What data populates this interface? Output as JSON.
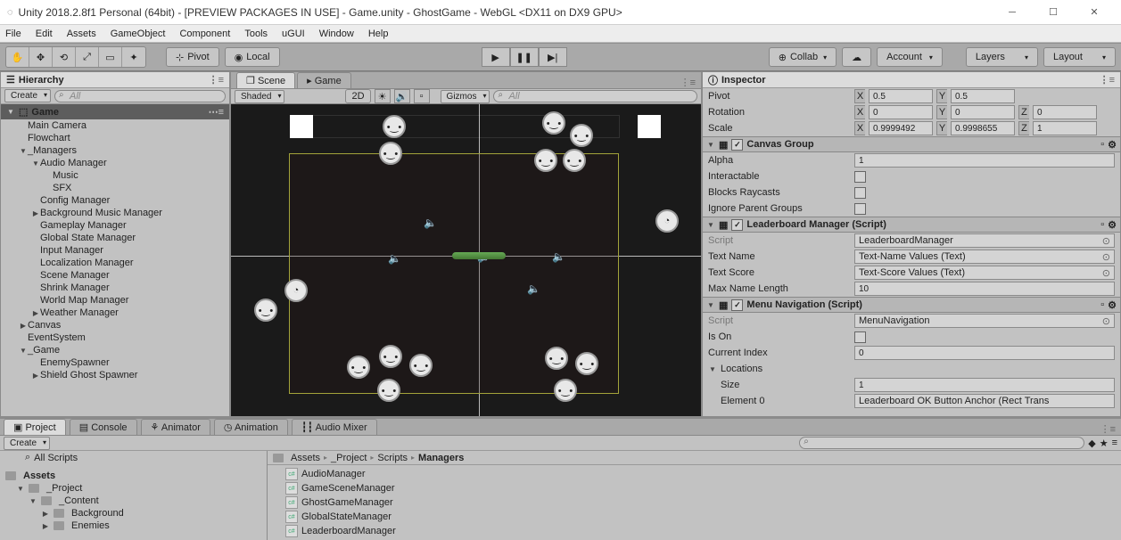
{
  "window": {
    "title": "Unity 2018.2.8f1 Personal (64bit) - [PREVIEW PACKAGES IN USE] - Game.unity - GhostGame - WebGL <DX11 on DX9 GPU>"
  },
  "menus": [
    "File",
    "Edit",
    "Assets",
    "GameObject",
    "Component",
    "Tools",
    "uGUI",
    "Window",
    "Help"
  ],
  "toolbar": {
    "pivot": "Pivot",
    "local": "Local",
    "collab": "Collab",
    "account": "Account",
    "layers": "Layers",
    "layout": "Layout"
  },
  "hierarchy": {
    "tab": "Hierarchy",
    "create": "Create",
    "searchPlaceholder": "All",
    "root": "Game",
    "items": [
      {
        "label": "Main Camera",
        "indent": 1
      },
      {
        "label": "Flowchart",
        "indent": 1
      },
      {
        "label": "_Managers",
        "indent": 1,
        "tri": "▼"
      },
      {
        "label": "Audio Manager",
        "indent": 2,
        "tri": "▼"
      },
      {
        "label": "Music",
        "indent": 3
      },
      {
        "label": "SFX",
        "indent": 3
      },
      {
        "label": "Config Manager",
        "indent": 2
      },
      {
        "label": "Background Music Manager",
        "indent": 2,
        "tri": "▶"
      },
      {
        "label": "Gameplay Manager",
        "indent": 2
      },
      {
        "label": "Global State Manager",
        "indent": 2
      },
      {
        "label": "Input Manager",
        "indent": 2
      },
      {
        "label": "Localization Manager",
        "indent": 2
      },
      {
        "label": "Scene Manager",
        "indent": 2
      },
      {
        "label": "Shrink Manager",
        "indent": 2
      },
      {
        "label": "World Map Manager",
        "indent": 2
      },
      {
        "label": "Weather Manager",
        "indent": 2,
        "tri": "▶"
      },
      {
        "label": "Canvas",
        "indent": 1,
        "tri": "▶"
      },
      {
        "label": "EventSystem",
        "indent": 1
      },
      {
        "label": "_Game",
        "indent": 1,
        "tri": "▼"
      },
      {
        "label": "EnemySpawner",
        "indent": 2
      },
      {
        "label": "Shield Ghost Spawner",
        "indent": 2,
        "tri": "▶"
      }
    ]
  },
  "scene": {
    "tabScene": "Scene",
    "tabGame": "Game",
    "shading": "Shaded",
    "mode2d": "2D",
    "gizmos": "Gizmos",
    "searchPlaceholder": "All"
  },
  "inspector": {
    "tab": "Inspector",
    "transform": {
      "pivotLabel": "Pivot",
      "pivotX": "0.5",
      "pivotY": "0.5",
      "rotLabel": "Rotation",
      "rotX": "0",
      "rotY": "0",
      "rotZ": "0",
      "scaleLabel": "Scale",
      "scaleX": "0.9999492",
      "scaleY": "0.9998655",
      "scaleZ": "1"
    },
    "canvasGroup": {
      "title": "Canvas Group",
      "alphaLabel": "Alpha",
      "alpha": "1",
      "interactableLabel": "Interactable",
      "blocksLabel": "Blocks Raycasts",
      "ignoreLabel": "Ignore Parent Groups"
    },
    "leaderboard": {
      "title": "Leaderboard Manager (Script)",
      "scriptLabel": "Script",
      "script": "LeaderboardManager",
      "textNameLabel": "Text Name",
      "textName": "Text-Name Values (Text)",
      "textScoreLabel": "Text Score",
      "textScore": "Text-Score Values (Text)",
      "maxNameLabel": "Max Name Length",
      "maxName": "10"
    },
    "menuNav": {
      "title": "Menu Navigation (Script)",
      "scriptLabel": "Script",
      "script": "MenuNavigation",
      "isOnLabel": "Is On",
      "curIdxLabel": "Current Index",
      "curIdx": "0",
      "locLabel": "Locations",
      "sizeLabel": "Size",
      "size": "1",
      "el0Label": "Element 0",
      "el0": "Leaderboard OK Button Anchor (Rect Trans"
    }
  },
  "project": {
    "tabs": [
      "Project",
      "Console",
      "Animator",
      "Animation",
      "Audio Mixer"
    ],
    "create": "Create",
    "searchPlaceholder": "",
    "allscripts": "All Scripts",
    "assets": {
      "title": "Assets",
      "tree": [
        "_Project",
        "_Content",
        "Background",
        "Enemies"
      ]
    },
    "breadcrumb": [
      "Assets",
      "_Project",
      "Scripts",
      "Managers"
    ],
    "files": [
      "AudioManager",
      "GameSceneManager",
      "GhostGameManager",
      "GlobalStateManager",
      "LeaderboardManager"
    ]
  }
}
